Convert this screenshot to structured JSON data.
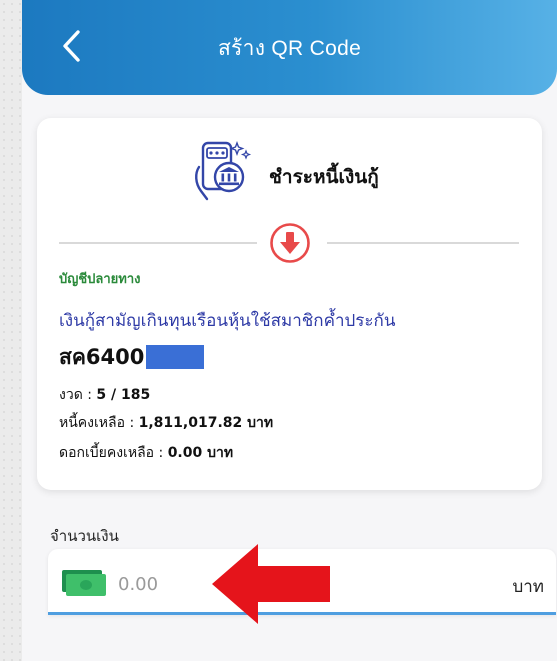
{
  "header": {
    "title": "สร้าง QR Code",
    "back_icon": "chevron-left-icon"
  },
  "service": {
    "icon": "bank-payment-icon",
    "title": "ชำระหนี้เงินกู้",
    "arrow_icon": "arrow-down-circle-icon"
  },
  "destination": {
    "label": "บัญชีปลายทาง",
    "loan_name": "เงินกู้สามัญเกินทุนเรือนหุ้นใช้สมาชิกค้ำประกัน",
    "account_no": "สค6400"
  },
  "details": {
    "installment_label": "งวด :",
    "installment_value": "5 / 185",
    "balance_label": "หนี้คงเหลือ :",
    "balance_value": "1,811,017.82 บาท",
    "interest_label": "ดอกเบี้ยคงเหลือ :",
    "interest_value": "0.00 บาท"
  },
  "amount": {
    "label": "จำนวนเงิน",
    "placeholder": "0.00",
    "currency": "บาท",
    "icon": "cash-icon"
  },
  "colors": {
    "header_start": "#1c79c0",
    "header_end": "#57b1e6",
    "label_green": "#2a8a3a",
    "loan_blue": "#2e3aa6",
    "annotation_red": "#e5141b"
  }
}
